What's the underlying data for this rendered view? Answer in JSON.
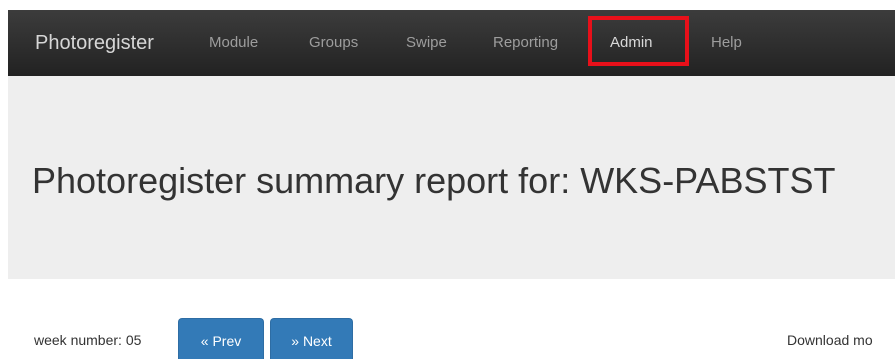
{
  "navbar": {
    "brand": "Photoregister",
    "items": [
      {
        "label": "Module"
      },
      {
        "label": "Groups"
      },
      {
        "label": "Swipe"
      },
      {
        "label": "Reporting"
      },
      {
        "label": "Admin"
      },
      {
        "label": "Help"
      }
    ],
    "highlighted_item": "Admin",
    "highlight_color": "#e8101a",
    "background_color": "#222222"
  },
  "jumbotron": {
    "title": "Photoregister summary report for: WKS-PABSTST",
    "background_color": "#eeeeee"
  },
  "controls": {
    "week_label": "week number: 05",
    "prev_label": "« Prev",
    "next_label": "» Next",
    "button_color": "#337ab7",
    "download_text": "Download mo"
  }
}
